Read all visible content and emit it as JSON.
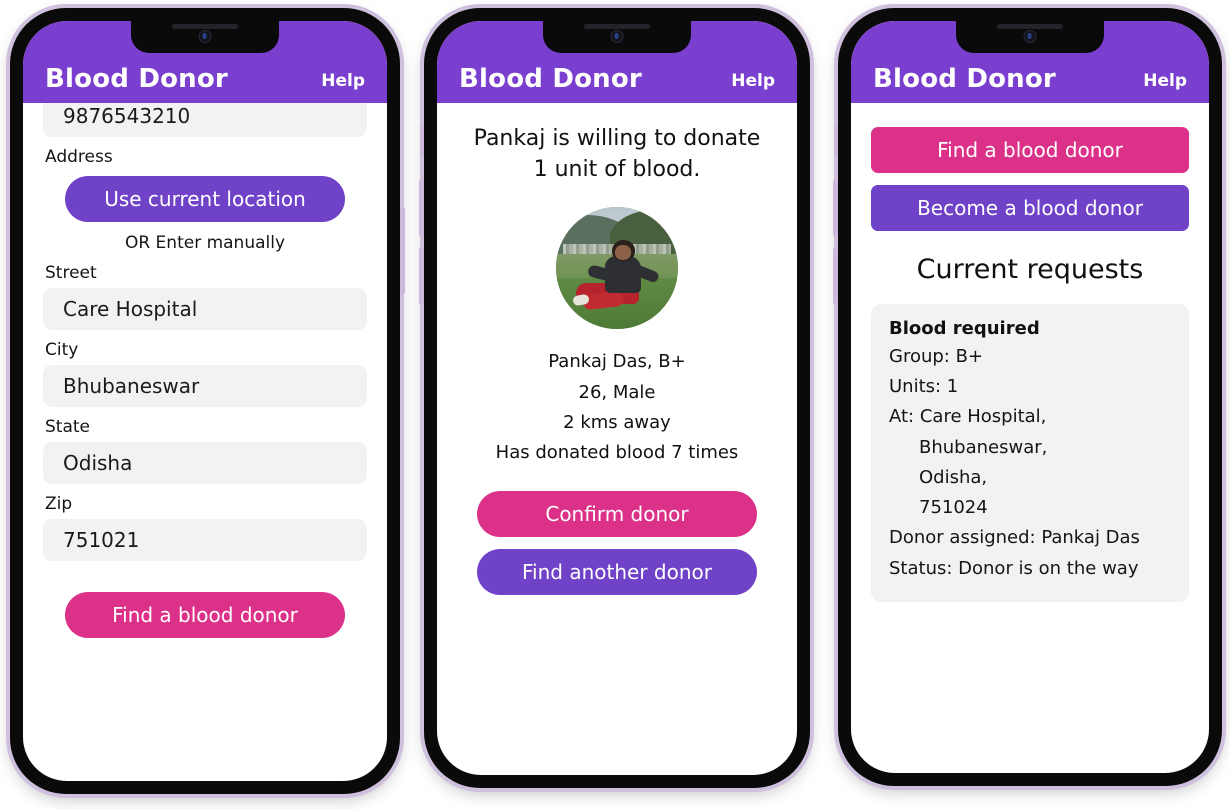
{
  "app": {
    "title": "Blood Donor",
    "help_label": "Help",
    "colors": {
      "header_purple": "#7b3fcf",
      "button_purple": "#6f42c8",
      "button_pink": "#dc3188",
      "input_background": "#f2f2f2",
      "phone_frame": "#0a0a0a",
      "phone_outline": "#cfc0dd"
    }
  },
  "screen1": {
    "phone_value": "9876543210",
    "address_label": "Address",
    "use_location_button": "Use current location",
    "or_note": "OR Enter manually",
    "street_label": "Street",
    "street_value": "Care Hospital",
    "city_label": "City",
    "city_value": "Bhubaneswar",
    "state_label": "State",
    "state_value": "Odisha",
    "zip_label": "Zip",
    "zip_value": "751021",
    "find_button": "Find a blood donor"
  },
  "screen2": {
    "headline_line1": "Pankaj is willing to donate",
    "headline_line2": "1 unit of blood.",
    "avatar_alt": "donor-photo",
    "name_group": "Pankaj Das, B+",
    "age_gender": "26, Male",
    "distance": "2 kms away",
    "donation_count": "Has donated blood 7 times",
    "confirm_button": "Confirm donor",
    "find_another_button": "Find another donor"
  },
  "screen3": {
    "find_button": "Find a blood donor",
    "become_button": "Become a blood donor",
    "section_title": "Current requests",
    "request": {
      "title": "Blood required",
      "group": "Group: B+",
      "units": "Units: 1",
      "at": "At: Care Hospital,",
      "address_line2": "Bhubaneswar,",
      "address_line3": "Odisha,",
      "address_line4": "751024",
      "donor_assigned": "Donor assigned: Pankaj Das",
      "status": "Status: Donor is on the way"
    }
  }
}
